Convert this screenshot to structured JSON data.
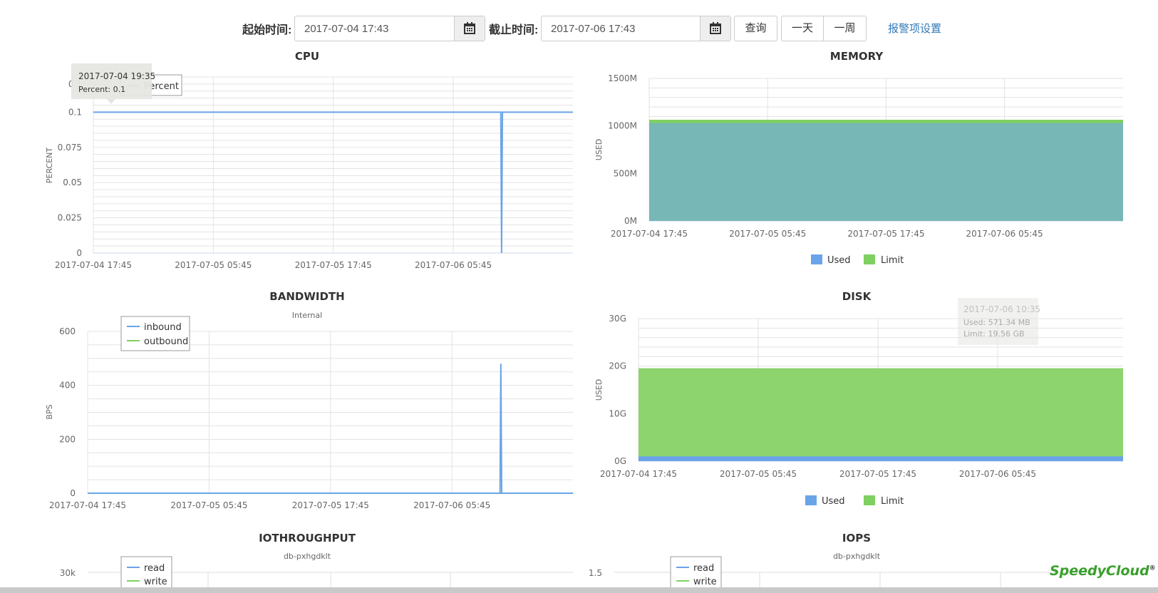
{
  "toolbar": {
    "start_label": "起始时间:",
    "start_value": "2017-07-04 17:43",
    "end_label": "截止时间:",
    "end_value": "2017-07-06 17:43",
    "query_button": "查询",
    "day_button": "一天",
    "week_button": "一周",
    "alert_link": "报警项设置"
  },
  "brand": {
    "text": "SpeedyCloud",
    "mark": "®"
  },
  "colors": {
    "blue": "#6aa4e8",
    "green": "#7fd061",
    "memory_area": "#77b8b7"
  },
  "charts": {
    "cpu": {
      "title": "CPU",
      "ylabel": "PERCENT",
      "legend": [
        "Percent"
      ],
      "tooltip": [
        "2017-07-04 19:35",
        "Percent: 0.1"
      ],
      "x_ticks": [
        "2017-07-04 17:45",
        "2017-07-05 05:45",
        "2017-07-05 17:45",
        "2017-07-06 05:45"
      ],
      "y_ticks": [
        "0",
        "0.025",
        "0.05",
        "0.075",
        "0.1",
        "0.1"
      ]
    },
    "memory": {
      "title": "MEMORY",
      "ylabel": "USED",
      "legend": [
        "Used",
        "Limit"
      ],
      "x_ticks": [
        "2017-07-04 17:45",
        "2017-07-05 05:45",
        "2017-07-05 17:45",
        "2017-07-06 05:45"
      ],
      "y_ticks": [
        "0M",
        "500M",
        "1000M",
        "1500M"
      ]
    },
    "bandwidth": {
      "title": "BANDWIDTH",
      "subtitle": "Internal",
      "ylabel": "BPS",
      "legend": [
        "inbound",
        "outbound"
      ],
      "x_ticks": [
        "2017-07-04 17:45",
        "2017-07-05 05:45",
        "2017-07-05 17:45",
        "2017-07-06 05:45"
      ],
      "y_ticks": [
        "0",
        "200",
        "400",
        "600"
      ]
    },
    "disk": {
      "title": "DISK",
      "ylabel": "USED",
      "legend": [
        "Used",
        "Limit"
      ],
      "tooltip": [
        "2017-07-06 10:35",
        "Used: 571.34 MB",
        "Limit: 19.56 GB"
      ],
      "x_ticks": [
        "2017-07-04 17:45",
        "2017-07-05 05:45",
        "2017-07-05 17:45",
        "2017-07-06 05:45"
      ],
      "y_ticks": [
        "0G",
        "10G",
        "20G",
        "30G"
      ]
    },
    "iothroughput": {
      "title": "IOTHROUGHPUT",
      "subtitle": "db-pxhgdklt",
      "legend": [
        "read",
        "write"
      ],
      "y_ticks": [
        "30k"
      ]
    },
    "iops": {
      "title": "IOPS",
      "subtitle": "db-pxhgdklt",
      "legend": [
        "read",
        "write"
      ],
      "y_ticks": [
        "1.5"
      ]
    }
  },
  "chart_data": [
    {
      "type": "line",
      "title": "CPU",
      "ylabel": "PERCENT",
      "x": [
        "2017-07-04 17:45",
        "2017-07-06 10:30",
        "2017-07-06 10:35",
        "2017-07-06 10:40",
        "2017-07-06 17:43"
      ],
      "series": [
        {
          "name": "Percent",
          "values": [
            0.1,
            0.1,
            0,
            0.1,
            0.1
          ]
        }
      ],
      "ylim": [
        0,
        0.125
      ],
      "grid": true,
      "legend": "top-left"
    },
    {
      "type": "area",
      "title": "MEMORY",
      "ylabel": "USED",
      "unit": "M",
      "x": [
        "2017-07-04 17:45",
        "2017-07-06 17:43"
      ],
      "series": [
        {
          "name": "Used",
          "values": [
            1030,
            1055
          ]
        },
        {
          "name": "Limit",
          "values": [
            1065,
            1065
          ]
        }
      ],
      "ylim": [
        0,
        1500
      ],
      "grid": true,
      "legend": "bottom"
    },
    {
      "type": "line",
      "title": "BANDWIDTH",
      "subtitle": "Internal",
      "ylabel": "BPS",
      "x": [
        "2017-07-04 17:45",
        "2017-07-06 10:30",
        "2017-07-06 10:35",
        "2017-07-06 10:40",
        "2017-07-06 17:43"
      ],
      "series": [
        {
          "name": "inbound",
          "values": [
            0,
            0,
            480,
            0,
            0
          ]
        },
        {
          "name": "outbound",
          "values": [
            0,
            0,
            0,
            0,
            0
          ]
        }
      ],
      "ylim": [
        0,
        600
      ],
      "grid": true,
      "legend": "top-left"
    },
    {
      "type": "area",
      "title": "DISK",
      "ylabel": "USED",
      "unit": "G",
      "x": [
        "2017-07-04 17:45",
        "2017-07-06 17:43"
      ],
      "series": [
        {
          "name": "Used",
          "values": [
            0.56,
            0.56
          ]
        },
        {
          "name": "Limit",
          "values": [
            19.56,
            19.56
          ]
        }
      ],
      "ylim": [
        0,
        30
      ],
      "grid": true,
      "legend": "bottom"
    }
  ]
}
